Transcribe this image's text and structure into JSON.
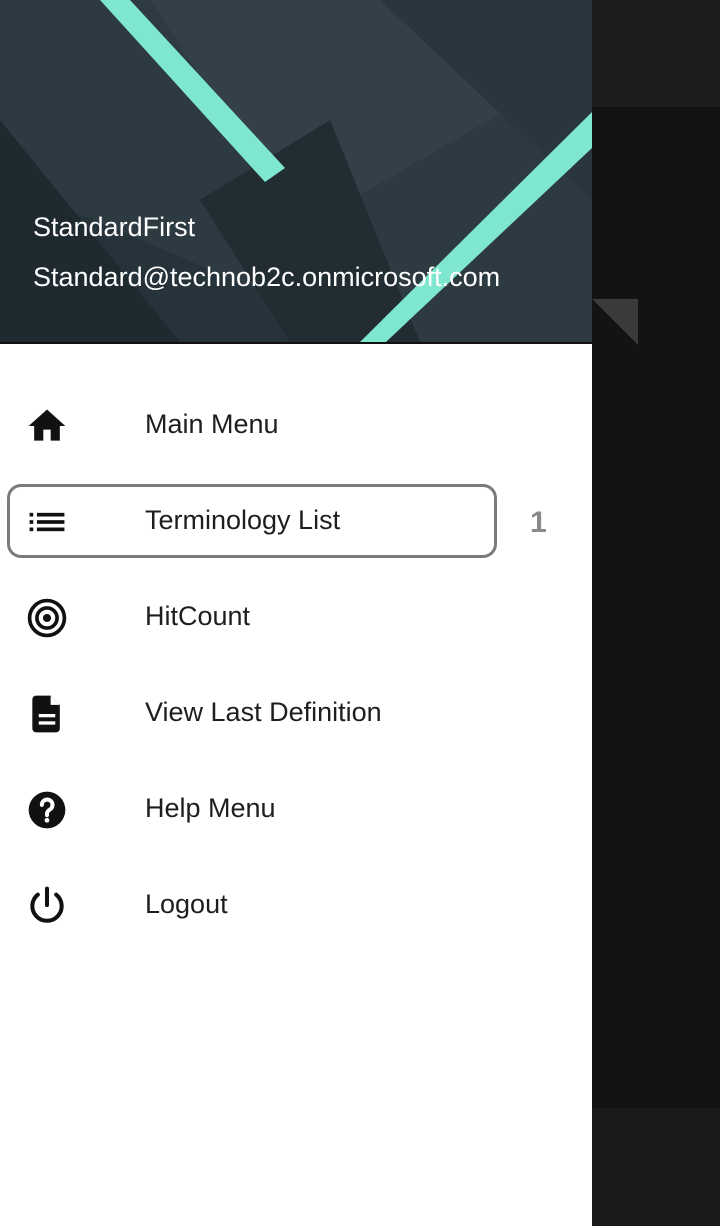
{
  "background_app": {
    "title_fragment": "/1"
  },
  "drawer": {
    "header": {
      "user_name": "StandardFirst",
      "user_email": "Standard@technob2c.onmicrosoft.com"
    },
    "menu": {
      "items": [
        {
          "label": "Main Menu",
          "icon": "home-icon"
        },
        {
          "label": "Terminology List",
          "icon": "list-icon",
          "selected": true
        },
        {
          "label": "HitCount",
          "icon": "target-icon"
        },
        {
          "label": "View Last Definition",
          "icon": "document-icon"
        },
        {
          "label": "Help Menu",
          "icon": "help-icon"
        },
        {
          "label": "Logout",
          "icon": "power-icon"
        }
      ]
    },
    "annotation_badge": "1"
  },
  "colors": {
    "header_background": "#26323a",
    "header_accent_stripe": "#7fe6cf",
    "selection_outline": "#7b7b7b"
  }
}
